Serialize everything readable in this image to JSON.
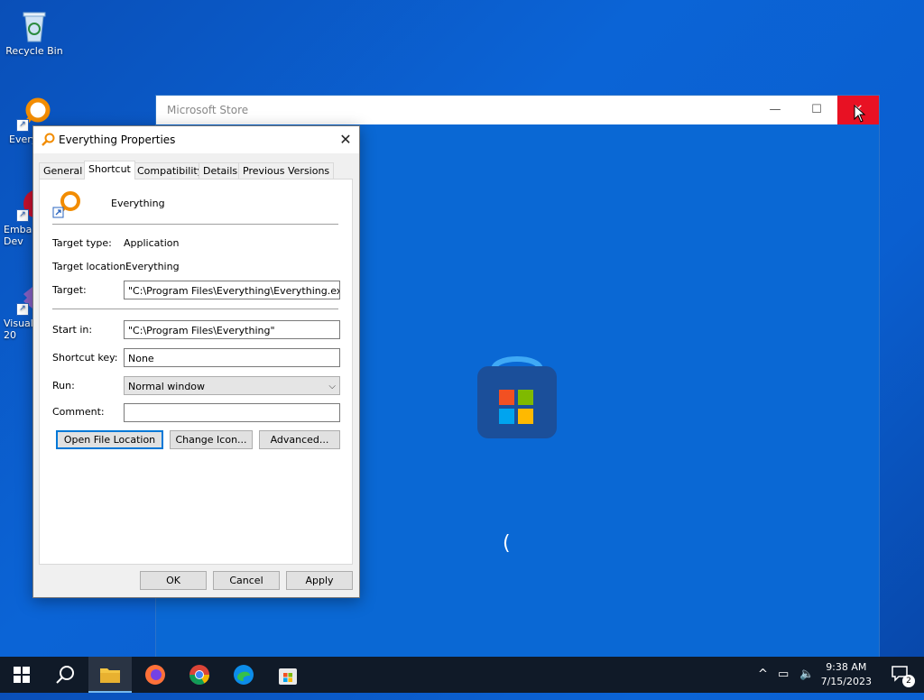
{
  "desktop": {
    "icons": [
      {
        "label": "Recycle Bin"
      },
      {
        "label": "Every"
      },
      {
        "label": "Emba Dev"
      },
      {
        "label": "Visual 20"
      }
    ]
  },
  "store_window": {
    "title": "Microsoft Store",
    "minimize_glyph": "—",
    "maximize_glyph": "☐",
    "close_glyph": "✕",
    "spinner_glyph": "("
  },
  "dialog": {
    "title": "Everything Properties",
    "close_glyph": "✕",
    "tabs": [
      {
        "label": "General"
      },
      {
        "label": "Shortcut"
      },
      {
        "label": "Compatibility"
      },
      {
        "label": "Details"
      },
      {
        "label": "Previous Versions"
      }
    ],
    "active_tab": "Shortcut",
    "app_name": "Everything",
    "target_type_label": "Target type:",
    "target_type_value": "Application",
    "target_location_label": "Target location:",
    "target_location_value": "Everything",
    "target_label": "Target:",
    "target_value": "\"C:\\Program Files\\Everything\\Everything.exe\"",
    "start_in_label": "Start in:",
    "start_in_value": "\"C:\\Program Files\\Everything\"",
    "shortcut_key_label": "Shortcut key:",
    "shortcut_key_value": "None",
    "run_label": "Run:",
    "run_value": "Normal window",
    "comment_label": "Comment:",
    "comment_value": "",
    "buttons": {
      "open_file_location": "Open File Location",
      "change_icon": "Change Icon...",
      "advanced": "Advanced...",
      "ok": "OK",
      "cancel": "Cancel",
      "apply": "Apply"
    }
  },
  "taskbar": {
    "time": "9:38 AM",
    "date": "7/15/2023",
    "notification_count": "2"
  },
  "colors": {
    "accent": "#0078d7",
    "close_red": "#e81123",
    "store_bg": "#0a68d4"
  }
}
